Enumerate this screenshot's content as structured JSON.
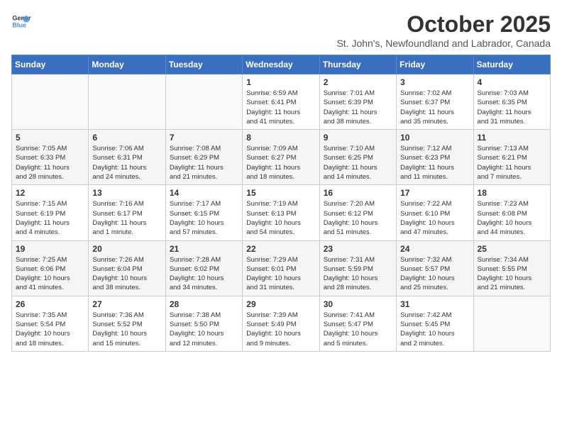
{
  "header": {
    "logo_line1": "General",
    "logo_line2": "Blue",
    "month": "October 2025",
    "location": "St. John's, Newfoundland and Labrador, Canada"
  },
  "days_of_week": [
    "Sunday",
    "Monday",
    "Tuesday",
    "Wednesday",
    "Thursday",
    "Friday",
    "Saturday"
  ],
  "weeks": [
    [
      {
        "day": "",
        "info": ""
      },
      {
        "day": "",
        "info": ""
      },
      {
        "day": "",
        "info": ""
      },
      {
        "day": "1",
        "info": "Sunrise: 6:59 AM\nSunset: 6:41 PM\nDaylight: 11 hours\nand 41 minutes."
      },
      {
        "day": "2",
        "info": "Sunrise: 7:01 AM\nSunset: 6:39 PM\nDaylight: 11 hours\nand 38 minutes."
      },
      {
        "day": "3",
        "info": "Sunrise: 7:02 AM\nSunset: 6:37 PM\nDaylight: 11 hours\nand 35 minutes."
      },
      {
        "day": "4",
        "info": "Sunrise: 7:03 AM\nSunset: 6:35 PM\nDaylight: 11 hours\nand 31 minutes."
      }
    ],
    [
      {
        "day": "5",
        "info": "Sunrise: 7:05 AM\nSunset: 6:33 PM\nDaylight: 11 hours\nand 28 minutes."
      },
      {
        "day": "6",
        "info": "Sunrise: 7:06 AM\nSunset: 6:31 PM\nDaylight: 11 hours\nand 24 minutes."
      },
      {
        "day": "7",
        "info": "Sunrise: 7:08 AM\nSunset: 6:29 PM\nDaylight: 11 hours\nand 21 minutes."
      },
      {
        "day": "8",
        "info": "Sunrise: 7:09 AM\nSunset: 6:27 PM\nDaylight: 11 hours\nand 18 minutes."
      },
      {
        "day": "9",
        "info": "Sunrise: 7:10 AM\nSunset: 6:25 PM\nDaylight: 11 hours\nand 14 minutes."
      },
      {
        "day": "10",
        "info": "Sunrise: 7:12 AM\nSunset: 6:23 PM\nDaylight: 11 hours\nand 11 minutes."
      },
      {
        "day": "11",
        "info": "Sunrise: 7:13 AM\nSunset: 6:21 PM\nDaylight: 11 hours\nand 7 minutes."
      }
    ],
    [
      {
        "day": "12",
        "info": "Sunrise: 7:15 AM\nSunset: 6:19 PM\nDaylight: 11 hours\nand 4 minutes."
      },
      {
        "day": "13",
        "info": "Sunrise: 7:16 AM\nSunset: 6:17 PM\nDaylight: 11 hours\nand 1 minute."
      },
      {
        "day": "14",
        "info": "Sunrise: 7:17 AM\nSunset: 6:15 PM\nDaylight: 10 hours\nand 57 minutes."
      },
      {
        "day": "15",
        "info": "Sunrise: 7:19 AM\nSunset: 6:13 PM\nDaylight: 10 hours\nand 54 minutes."
      },
      {
        "day": "16",
        "info": "Sunrise: 7:20 AM\nSunset: 6:12 PM\nDaylight: 10 hours\nand 51 minutes."
      },
      {
        "day": "17",
        "info": "Sunrise: 7:22 AM\nSunset: 6:10 PM\nDaylight: 10 hours\nand 47 minutes."
      },
      {
        "day": "18",
        "info": "Sunrise: 7:23 AM\nSunset: 6:08 PM\nDaylight: 10 hours\nand 44 minutes."
      }
    ],
    [
      {
        "day": "19",
        "info": "Sunrise: 7:25 AM\nSunset: 6:06 PM\nDaylight: 10 hours\nand 41 minutes."
      },
      {
        "day": "20",
        "info": "Sunrise: 7:26 AM\nSunset: 6:04 PM\nDaylight: 10 hours\nand 38 minutes."
      },
      {
        "day": "21",
        "info": "Sunrise: 7:28 AM\nSunset: 6:02 PM\nDaylight: 10 hours\nand 34 minutes."
      },
      {
        "day": "22",
        "info": "Sunrise: 7:29 AM\nSunset: 6:01 PM\nDaylight: 10 hours\nand 31 minutes."
      },
      {
        "day": "23",
        "info": "Sunrise: 7:31 AM\nSunset: 5:59 PM\nDaylight: 10 hours\nand 28 minutes."
      },
      {
        "day": "24",
        "info": "Sunrise: 7:32 AM\nSunset: 5:57 PM\nDaylight: 10 hours\nand 25 minutes."
      },
      {
        "day": "25",
        "info": "Sunrise: 7:34 AM\nSunset: 5:55 PM\nDaylight: 10 hours\nand 21 minutes."
      }
    ],
    [
      {
        "day": "26",
        "info": "Sunrise: 7:35 AM\nSunset: 5:54 PM\nDaylight: 10 hours\nand 18 minutes."
      },
      {
        "day": "27",
        "info": "Sunrise: 7:36 AM\nSunset: 5:52 PM\nDaylight: 10 hours\nand 15 minutes."
      },
      {
        "day": "28",
        "info": "Sunrise: 7:38 AM\nSunset: 5:50 PM\nDaylight: 10 hours\nand 12 minutes."
      },
      {
        "day": "29",
        "info": "Sunrise: 7:39 AM\nSunset: 5:49 PM\nDaylight: 10 hours\nand 9 minutes."
      },
      {
        "day": "30",
        "info": "Sunrise: 7:41 AM\nSunset: 5:47 PM\nDaylight: 10 hours\nand 5 minutes."
      },
      {
        "day": "31",
        "info": "Sunrise: 7:42 AM\nSunset: 5:45 PM\nDaylight: 10 hours\nand 2 minutes."
      },
      {
        "day": "",
        "info": ""
      }
    ]
  ]
}
